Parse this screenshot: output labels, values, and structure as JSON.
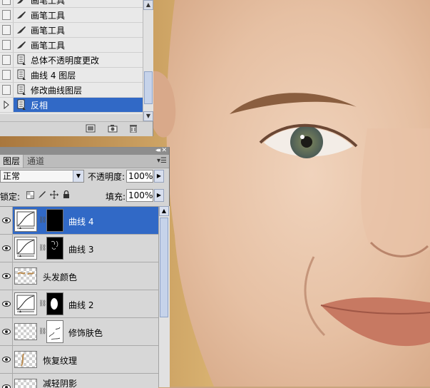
{
  "history": {
    "items": [
      {
        "label": "画笔工具",
        "icon": "brush-icon",
        "selected": false
      },
      {
        "label": "画笔工具",
        "icon": "brush-icon",
        "selected": false
      },
      {
        "label": "画笔工具",
        "icon": "brush-icon",
        "selected": false
      },
      {
        "label": "画笔工具",
        "icon": "brush-icon",
        "selected": false
      },
      {
        "label": "总体不透明度更改",
        "icon": "document-icon",
        "selected": false
      },
      {
        "label": "曲线 4 图层",
        "icon": "document-icon",
        "selected": false
      },
      {
        "label": "修改曲线图层",
        "icon": "document-icon",
        "selected": false
      },
      {
        "label": "反相",
        "icon": "document-icon",
        "selected": true
      }
    ],
    "footer_icons": [
      "new-document-from-state-icon",
      "new-snapshot-icon",
      "delete-state-icon"
    ]
  },
  "layers_panel": {
    "tabs": [
      {
        "label": "图层"
      },
      {
        "label": "通道"
      }
    ],
    "blend_mode": "正常",
    "opacity_label": "不透明度:",
    "opacity_value": "100%",
    "lock_label": "锁定:",
    "fill_label": "填充:",
    "fill_value": "100%",
    "layers": [
      {
        "name": "曲线 4",
        "type": "curves",
        "mask": "black",
        "selected": true
      },
      {
        "name": "曲线 3",
        "type": "curves",
        "mask": "sparse",
        "selected": false
      },
      {
        "name": "头发颜色",
        "type": "pixel",
        "mask": null,
        "selected": false
      },
      {
        "name": "曲线 2",
        "type": "curves",
        "mask": "white-blob",
        "selected": false
      },
      {
        "name": "修饰肤色",
        "type": "pixel",
        "mask": "sketch",
        "selected": false
      },
      {
        "name": "恢复纹理",
        "type": "pixel",
        "mask": null,
        "selected": false
      },
      {
        "name": "减轻阴影",
        "type": "pixel",
        "mask": null,
        "selected": false
      }
    ]
  },
  "colors": {
    "selection": "#3169c6",
    "panel_bg": "#d4d4d4",
    "skin": "#e6c0a4",
    "hair": "#c9a062"
  }
}
